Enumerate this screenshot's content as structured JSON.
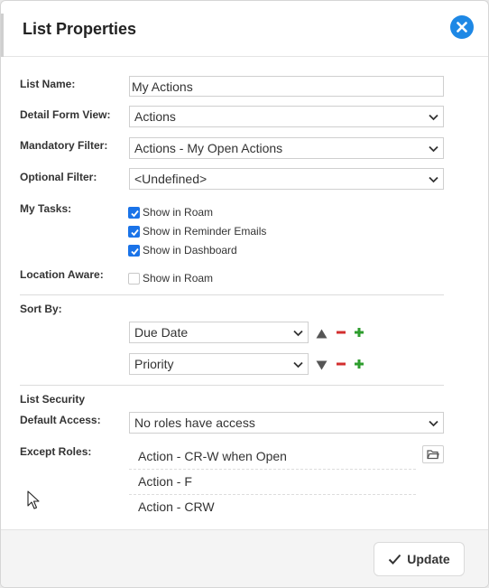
{
  "dialog": {
    "title": "List Properties",
    "close_label": "Close"
  },
  "form": {
    "list_name": {
      "label": "List Name:",
      "value": "My Actions"
    },
    "detail_form_view": {
      "label": "Detail Form View:",
      "value": "Actions"
    },
    "mandatory_filter": {
      "label": "Mandatory Filter:",
      "value": "Actions - My Open Actions"
    },
    "optional_filter": {
      "label": "Optional Filter:",
      "value": "<Undefined>"
    },
    "my_tasks": {
      "label": "My Tasks:",
      "options": [
        {
          "label": "Show in Roam",
          "checked": true
        },
        {
          "label": "Show in Reminder Emails",
          "checked": true
        },
        {
          "label": "Show in Dashboard",
          "checked": true
        }
      ]
    },
    "location_aware": {
      "label": "Location Aware:",
      "option": {
        "label": "Show in Roam",
        "checked": false
      }
    },
    "sort_by": {
      "label": "Sort By:",
      "fields": [
        {
          "value": "Due Date",
          "direction": "ascending"
        },
        {
          "value": "Priority",
          "direction": "descending"
        }
      ]
    },
    "list_security": {
      "heading": "List Security",
      "default_access": {
        "label": "Default Access:",
        "value": "No roles have access"
      },
      "except_roles": {
        "label": "Except Roles:",
        "roles": [
          "Action - CR-W when Open",
          "Action - F",
          "Action - CRW"
        ]
      }
    }
  },
  "footer": {
    "update_label": "Update"
  },
  "colors": {
    "accent": "#1e88e5",
    "checkbox": "#1a73e8",
    "remove": "#d32f2f",
    "add": "#2e9d2e"
  }
}
